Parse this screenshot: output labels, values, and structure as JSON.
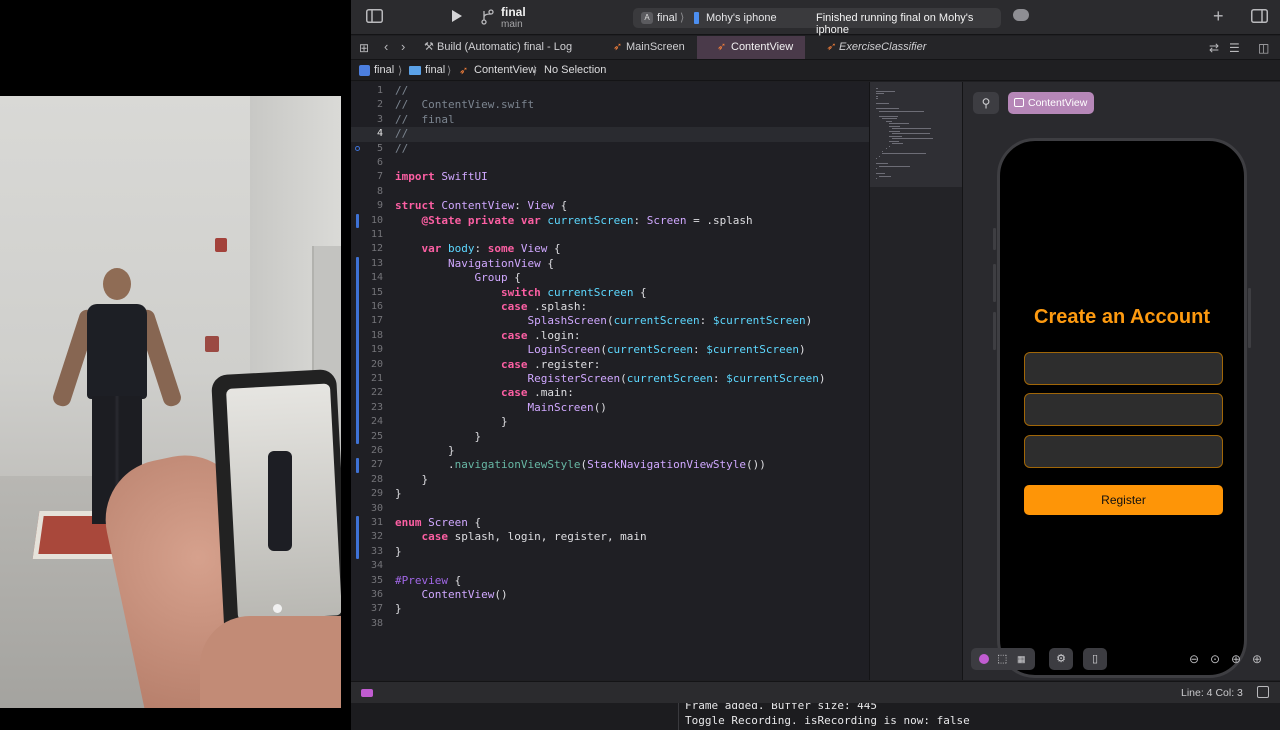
{
  "toolbar": {
    "project_title": "final",
    "branch": "main",
    "scheme_target": "final",
    "device": "Mohy's iphone",
    "status": "Finished running final on Mohy's iphone"
  },
  "tabs": [
    {
      "label": "Build (Automatic) final - Log"
    },
    {
      "label": "MainScreen"
    },
    {
      "label": "ContentView"
    },
    {
      "label": "ExerciseClassifier"
    }
  ],
  "breadcrumb": {
    "project": "final",
    "group": "final",
    "file": "ContentView",
    "selection": "No Selection"
  },
  "editor": {
    "current_line": 4,
    "lines": [
      "//",
      "//  ContentView.swift",
      "//  final",
      "//",
      "//",
      "",
      "import SwiftUI",
      "",
      "struct ContentView: View {",
      "    @State private var currentScreen: Screen = .splash",
      "",
      "    var body: some View {",
      "        NavigationView {",
      "            Group {",
      "                switch currentScreen {",
      "                case .splash:",
      "                    SplashScreen(currentScreen: $currentScreen)",
      "                case .login:",
      "                    LoginScreen(currentScreen: $currentScreen)",
      "                case .register:",
      "                    RegisterScreen(currentScreen: $currentScreen)",
      "                case .main:",
      "                    MainScreen()",
      "                }",
      "            }",
      "        }",
      "        .navigationViewStyle(StackNavigationViewStyle())",
      "    }",
      "}",
      "",
      "enum Screen {",
      "    case splash, login, register, main",
      "}",
      "",
      "#Preview {",
      "    ContentView()",
      "}",
      ""
    ]
  },
  "preview": {
    "chip_label": "ContentView",
    "screen_title": "Create an Account",
    "register_label": "Register"
  },
  "status_bar": {
    "cursor_position": "Line: 4  Col: 3"
  },
  "console": {
    "line1": "Frame added. Buffer size: 445",
    "line2": "Toggle Recording. isRecording is now: false"
  },
  "colors": {
    "accent_orange": "#fe9507",
    "keyword_pink": "#fc5fa3",
    "type_cyan": "#5dd8ff",
    "active_tab": "#4a3a4a"
  },
  "icons": {
    "navigator_toggle": "sidebar-icon",
    "run": "play-icon",
    "branch": "branch-icon",
    "add": "plus-icon",
    "inspector_toggle": "inspector-icon",
    "swift_file": "swift-icon"
  }
}
